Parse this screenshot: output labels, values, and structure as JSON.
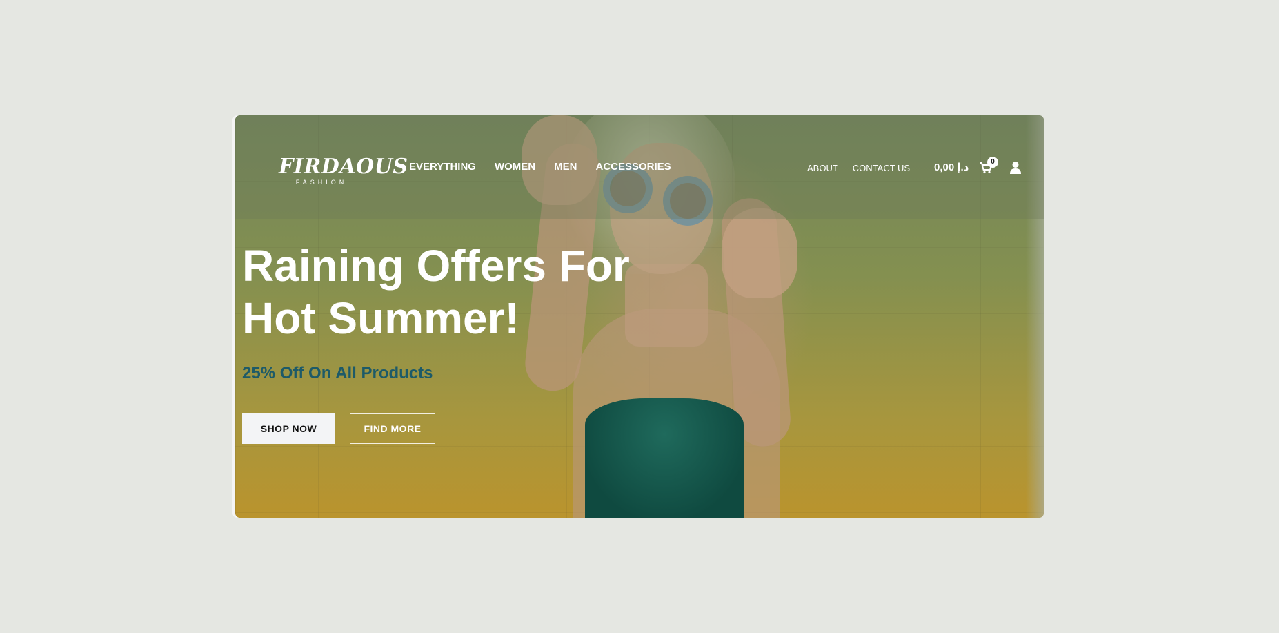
{
  "brand": {
    "logo_main": "FIRDAOUS",
    "logo_sub": "FASHION"
  },
  "nav": {
    "main": [
      "EVERYTHING",
      "WOMEN",
      "MEN",
      "ACCESSORIES"
    ],
    "secondary": [
      "ABOUT",
      "CONTACT US"
    ]
  },
  "cart": {
    "total": "0,00 د.إ",
    "count": "0",
    "icon": "shopping-cart-icon"
  },
  "account": {
    "icon": "user-icon"
  },
  "hero": {
    "title_line1": "Raining Offers For",
    "title_line2": "Hot Summer!",
    "subtitle": "25% Off On All Products",
    "primary_button": "SHOP NOW",
    "secondary_button": "FIND MORE"
  },
  "colors": {
    "page_background": "#e5e7e2",
    "subtitle": "#1d5a68",
    "primary_button_bg": "#f3f4f6"
  }
}
